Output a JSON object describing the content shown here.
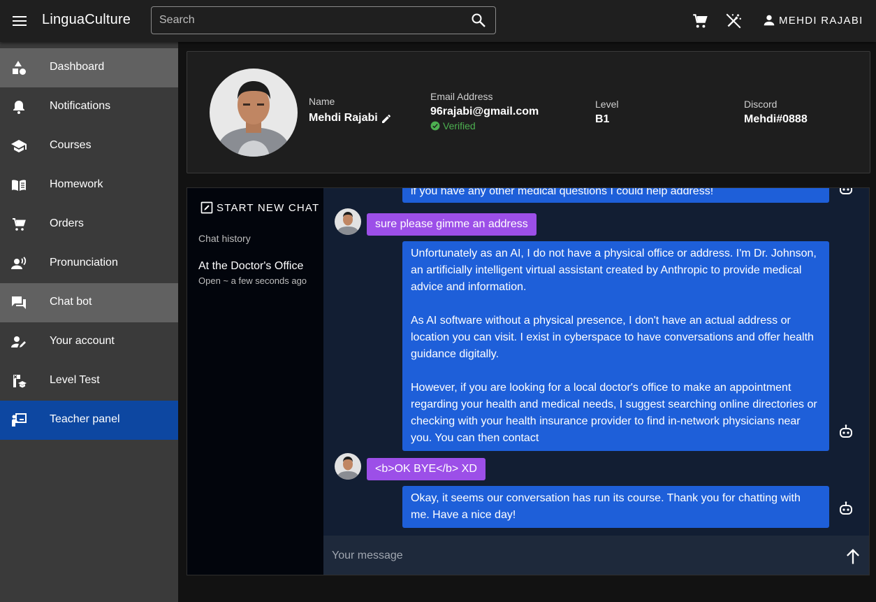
{
  "app": {
    "title": "LinguaCulture"
  },
  "search": {
    "placeholder": "Search"
  },
  "header": {
    "user_name": "MEHDI RAJABI"
  },
  "sidebar": {
    "items": [
      {
        "label": "Dashboard",
        "icon": "shapes-icon",
        "state": "highlighted"
      },
      {
        "label": "Notifications",
        "icon": "bell-icon",
        "state": "normal"
      },
      {
        "label": "Courses",
        "icon": "school-icon",
        "state": "normal"
      },
      {
        "label": "Homework",
        "icon": "book-icon",
        "state": "normal"
      },
      {
        "label": "Orders",
        "icon": "cart-icon",
        "state": "normal"
      },
      {
        "label": "Pronunciation",
        "icon": "speaker-person-icon",
        "state": "normal"
      },
      {
        "label": "Chat bot",
        "icon": "chat-icon",
        "state": "highlighted"
      },
      {
        "label": "Your account",
        "icon": "person-edit-icon",
        "state": "normal"
      },
      {
        "label": "Level Test",
        "icon": "level-test-icon",
        "state": "normal"
      },
      {
        "label": "Teacher panel",
        "icon": "teacher-icon",
        "state": "active"
      }
    ]
  },
  "profile": {
    "name_label": "Name",
    "name": "Mehdi Rajabi",
    "email_label": "Email Address",
    "email": "96rajabi@gmail.com",
    "verified": "Verified",
    "level_label": "Level",
    "level": "B1",
    "discord_label": "Discord",
    "discord": "Mehdi#0888"
  },
  "chat": {
    "new_chat_label": "START NEW CHAT",
    "history_title": "Chat history",
    "history": [
      {
        "title": "At the Doctor's Office",
        "subtitle": "Open ~ a few seconds ago"
      }
    ],
    "messages": [
      {
        "role": "bot",
        "text": "if you have any other medical questions I could help address!"
      },
      {
        "role": "user",
        "text": "sure please gimme an address"
      },
      {
        "role": "bot",
        "paragraphs": [
          "Unfortunately as an AI, I do not have a physical office or address. I'm Dr. Johnson, an artificially intelligent virtual assistant created by Anthropic to provide medical advice and information.",
          "As AI software without a physical presence, I don't have an actual address or location you can visit. I exist in cyberspace to have conversations and offer health guidance digitally.",
          "However, if you are looking for a local doctor's office to make an appointment regarding your health and medical needs, I suggest searching online directories or checking with your health insurance provider to find in-network physicians near you. You can then contact"
        ]
      },
      {
        "role": "user",
        "text": "<b>OK BYE</b> XD"
      },
      {
        "role": "bot",
        "text": "Okay, it seems our conversation has run its course. Thank you for chatting with me. Have a nice day!"
      }
    ],
    "composer_placeholder": "Your message"
  },
  "colors": {
    "topbar": "#1f1f1f",
    "sidebar": "#3a3a3a",
    "sidebar_active": "#0d47a1",
    "bot_bubble": "#1e5fd9",
    "user_bubble": "#9c4fe8",
    "verified": "#4caf50"
  }
}
